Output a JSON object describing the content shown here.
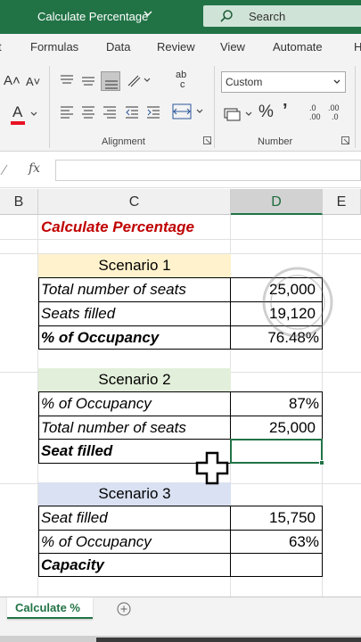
{
  "titlebar": {
    "doc_title": "Calculate Percentage",
    "search_placeholder": "Search",
    "bg": "#217346"
  },
  "tabs": [
    "t",
    "Formulas",
    "Data",
    "Review",
    "View",
    "Automate",
    "H"
  ],
  "ribbon": {
    "alignment_label": "Alignment",
    "number_label": "Number",
    "number_format": "Custom",
    "percent_symbol": "%",
    "comma_symbol": "’",
    "font_grow": "A˄",
    "font_shrink": "A˅",
    "font_color_letter": "A",
    "font_color": "#e81123",
    "wrap_glyph": "ab",
    "wrap_glyph_2": "c",
    "inc_decimal": ".0",
    "inc_decimal_2": ".00",
    "dec_decimal": ".00",
    "dec_decimal_2": ".0"
  },
  "formula_bar": {
    "fx": "fx",
    "value": ""
  },
  "columns": [
    "B",
    "C",
    "D",
    "E"
  ],
  "selected_column": "D",
  "sheet": {
    "title": "Calculate Percentage",
    "title_color": "#c00000",
    "scenario1": {
      "header": "Scenario 1",
      "header_bg": "#fff2cc",
      "rows": [
        {
          "label": "Total number of seats",
          "value": "25,000"
        },
        {
          "label": "Seats filled",
          "value": "19,120"
        },
        {
          "label": "% of Occupancy",
          "value": "76.48%"
        }
      ]
    },
    "scenario2": {
      "header": "Scenario 2",
      "header_bg": "#e2efda",
      "rows": [
        {
          "label": "% of Occupancy",
          "value": "87%"
        },
        {
          "label": "Total number of seats",
          "value": "25,000"
        },
        {
          "label": "Seat filled",
          "value": ""
        }
      ]
    },
    "scenario3": {
      "header": "Scenario 3",
      "header_bg": "#d9e1f2",
      "rows": [
        {
          "label": "Seat filled",
          "value": "15,750"
        },
        {
          "label": "% of Occupancy",
          "value": "63%"
        },
        {
          "label": "Capacity",
          "value": ""
        }
      ]
    }
  },
  "sheet_tabs": {
    "active": "Calculate %",
    "add": "+"
  },
  "accent": "#217346"
}
